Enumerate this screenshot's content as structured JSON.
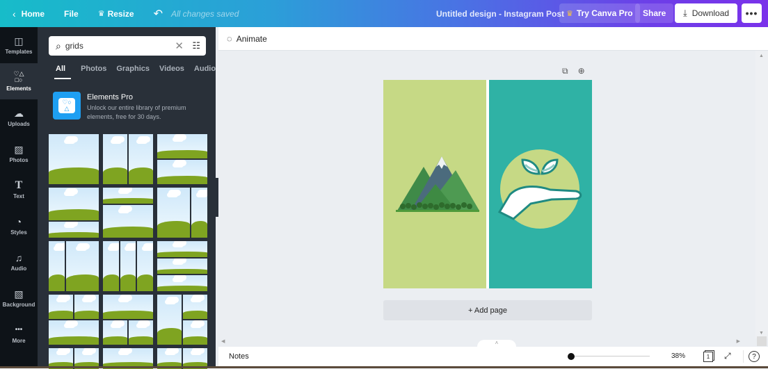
{
  "topbar": {
    "home_label": "Home",
    "file_label": "File",
    "resize_label": "Resize",
    "status": "All changes saved",
    "design_title": "Untitled design - Instagram Post",
    "try_pro_label": "Try Canva Pro",
    "share_label": "Share",
    "download_label": "Download",
    "more_label": "•••"
  },
  "rail": {
    "items": [
      {
        "label": "Templates",
        "icon": "templates-icon",
        "glyph": "◫"
      },
      {
        "label": "Elements",
        "icon": "elements-icon",
        "glyph": "♡△\n□○"
      },
      {
        "label": "Uploads",
        "icon": "upload-cloud-icon",
        "glyph": "☁"
      },
      {
        "label": "Photos",
        "icon": "photos-icon",
        "glyph": "▨"
      },
      {
        "label": "Text",
        "icon": "text-icon",
        "glyph": "T"
      },
      {
        "label": "Styles",
        "icon": "palette-icon",
        "glyph": "◔"
      },
      {
        "label": "Audio",
        "icon": "music-note-icon",
        "glyph": "♫"
      },
      {
        "label": "Background",
        "icon": "background-icon",
        "glyph": "▧"
      },
      {
        "label": "More",
        "icon": "more-icon",
        "glyph": "•••"
      }
    ],
    "active": "Elements"
  },
  "panel": {
    "search_value": "grids",
    "tabs": [
      "All",
      "Photos",
      "Graphics",
      "Videos",
      "Audio"
    ],
    "active_tab": "All",
    "promo": {
      "title": "Elements Pro",
      "description": "Unlock our entire library of premium elements, free for 30 days."
    },
    "grid_thumbnails": [
      {
        "name": "grid-1x1"
      },
      {
        "name": "grid-2-columns"
      },
      {
        "name": "grid-2-rows"
      },
      {
        "name": "grid-2-rows-large-top"
      },
      {
        "name": "grid-2-rows-small-top"
      },
      {
        "name": "grid-2-columns-wide-left"
      },
      {
        "name": "grid-2-columns-narrow-left"
      },
      {
        "name": "grid-3-columns"
      },
      {
        "name": "grid-3-rows"
      },
      {
        "name": "grid-2x2"
      },
      {
        "name": "grid-1-top-2-bottom"
      },
      {
        "name": "grid-1-left-2-right"
      },
      {
        "name": "grid-2-columns-partial"
      },
      {
        "name": "grid-1-row-partial"
      },
      {
        "name": "grid-2x2-partial"
      }
    ]
  },
  "editor": {
    "animate_label": "Animate",
    "add_page_label": "+ Add page",
    "design_colors": {
      "left": "#c6d985",
      "right": "#2fb2a5"
    }
  },
  "footer": {
    "notes_label": "Notes",
    "zoom_percent": "38%",
    "zoom_value": 38,
    "page_count": "1",
    "help_label": "?"
  }
}
